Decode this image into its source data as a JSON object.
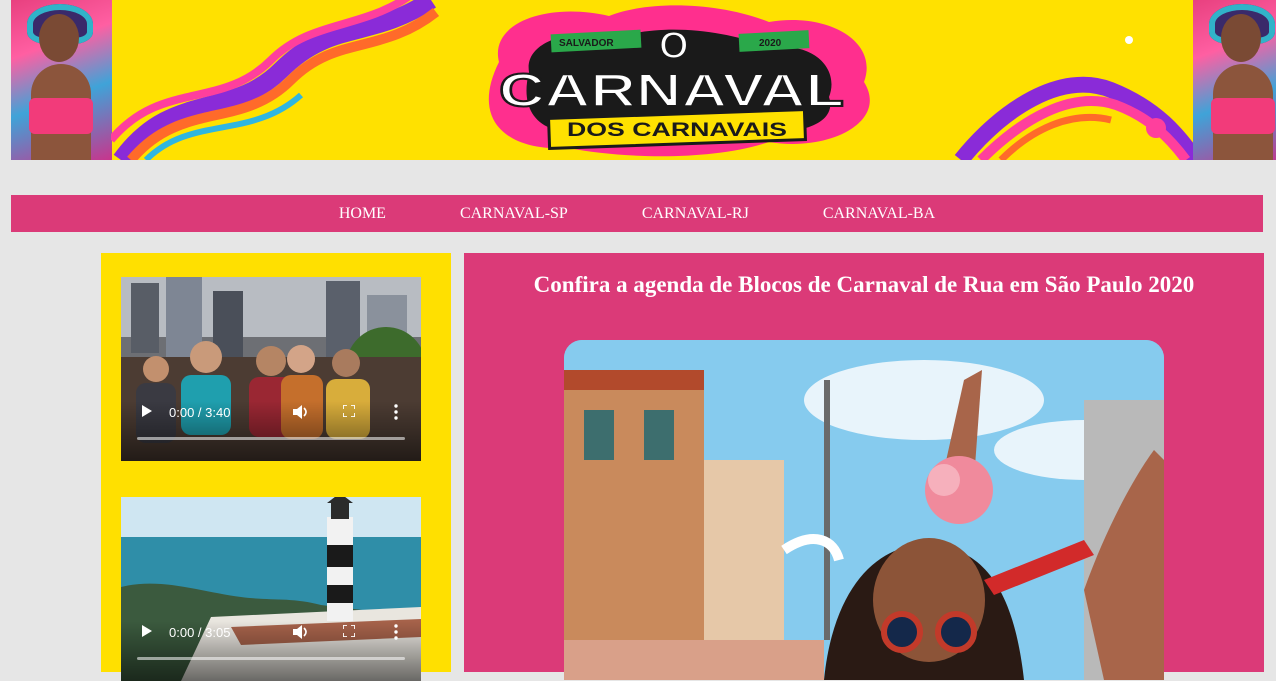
{
  "banner": {
    "logo_top": "O",
    "logo_main": "CARNAVAL",
    "logo_sub": "DOS CARNAVAIS",
    "logo_city": "SALVADOR",
    "logo_year": "2020"
  },
  "nav": {
    "items": [
      {
        "label": "HOME"
      },
      {
        "label": "CARNAVAL-SP"
      },
      {
        "label": "CARNAVAL-RJ"
      },
      {
        "label": "CARNAVAL-BA"
      }
    ]
  },
  "sidebar": {
    "videos": [
      {
        "time": "0:00 / 3:40"
      },
      {
        "time": "0:00 / 3:05"
      }
    ]
  },
  "main": {
    "title": "Confira a agenda de Blocos de Carnaval de Rua em São Paulo 2020"
  },
  "colors": {
    "banner_bg": "#ffe100",
    "accent_pink": "#db3a78",
    "sidebar_bg": "#ffe000",
    "page_bg": "#e6e6e6"
  },
  "icons": [
    "play-icon",
    "volume-icon",
    "fullscreen-icon",
    "more-options-icon"
  ]
}
